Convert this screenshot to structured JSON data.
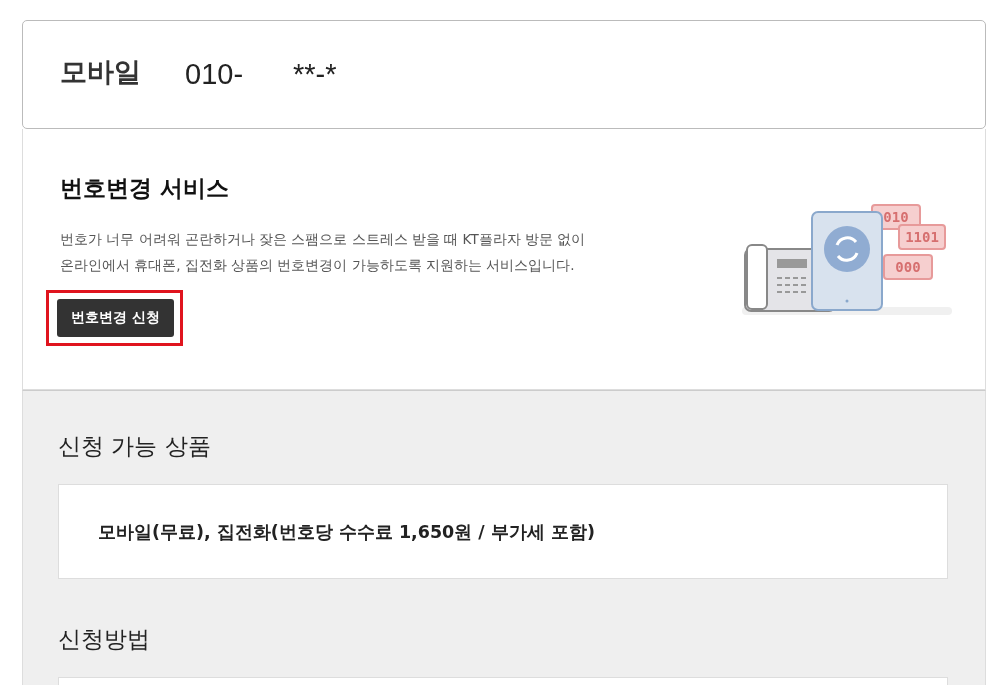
{
  "header": {
    "label": "모바일",
    "number_start": "010-",
    "number_end": "**-*"
  },
  "service": {
    "title": "번호변경 서비스",
    "description_lines": [
      "번호가 너무 어려워 곤란하거나 잦은 스팸으로 스트레스 받을 때 KT플라자 방문 없이",
      "온라인에서 휴대폰, 집전화 상품의 번호변경이 가능하도록 지원하는 서비스입니다."
    ],
    "button": {
      "label": "번호변경 신청",
      "highlighted": true
    },
    "illustration": {
      "codes": [
        "010",
        "1101",
        "000"
      ]
    }
  },
  "sections": [
    {
      "title": "신청 가능 상품",
      "content": "모바일(무료), 집전화(번호당 수수료 1,650원 / 부가세 포함)"
    },
    {
      "title": "신청방법"
    }
  ]
}
